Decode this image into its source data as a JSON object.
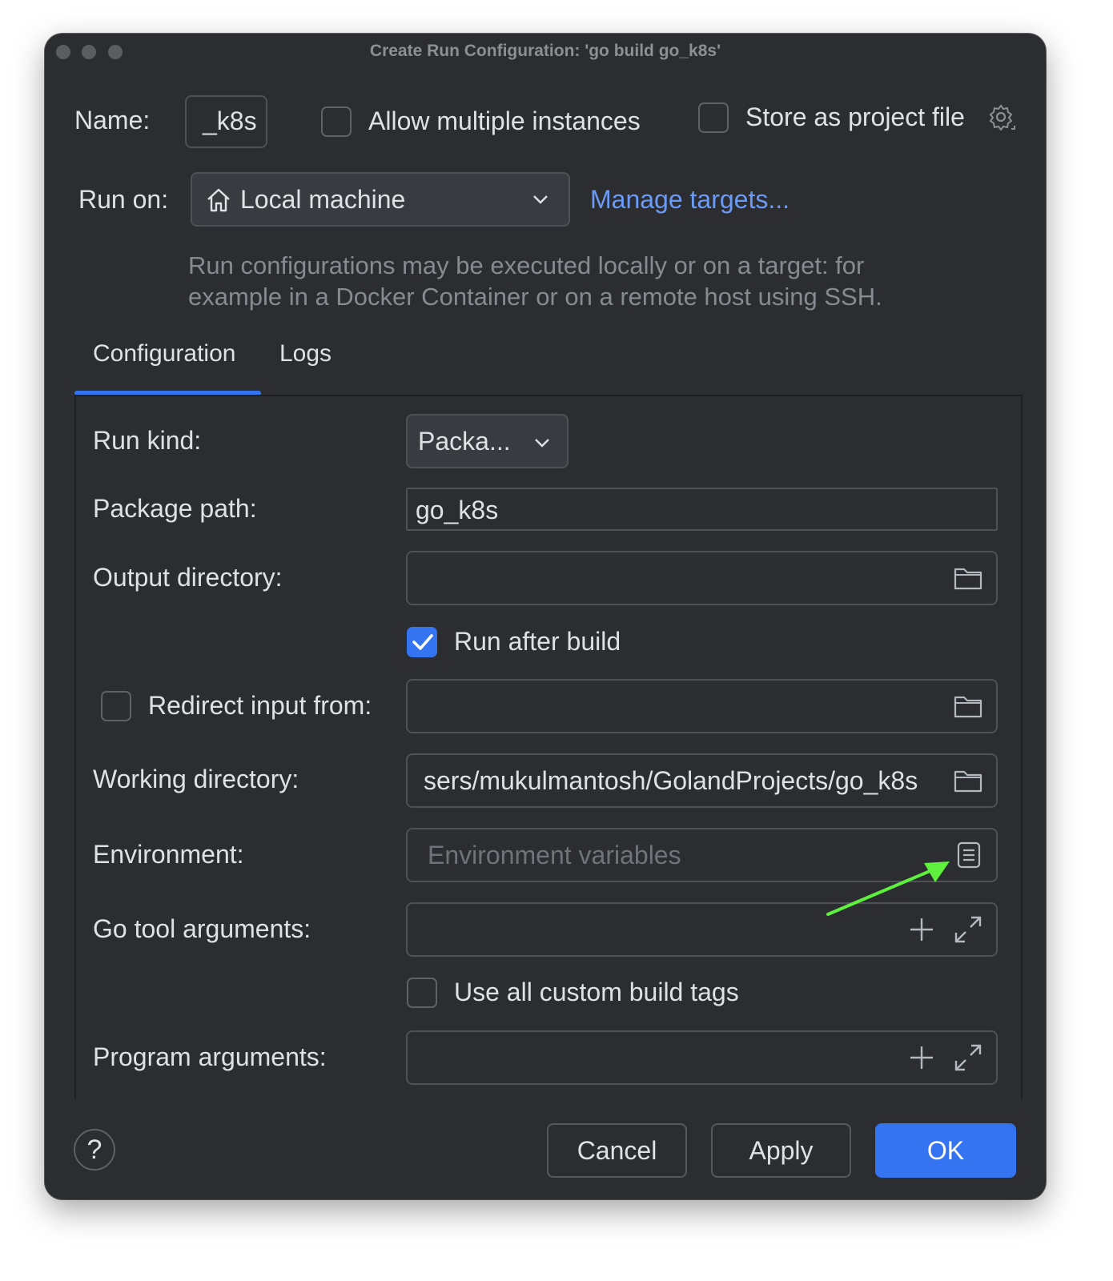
{
  "window": {
    "title": "Create Run Configuration: 'go build go_k8s'"
  },
  "header": {
    "name_label": "Name:",
    "name_value": "_k8s",
    "allow_multiple_label": "Allow multiple instances",
    "allow_multiple_checked": false,
    "store_project_label": "Store as project file",
    "store_project_checked": false
  },
  "run_on": {
    "label": "Run on:",
    "selected": "Local machine",
    "manage_targets": "Manage targets...",
    "hint_line1": "Run configurations may be executed locally or on a target: for",
    "hint_line2": "example in a Docker Container or on a remote host using SSH."
  },
  "tabs": [
    {
      "label": "Configuration",
      "active": true
    },
    {
      "label": "Logs",
      "active": false
    }
  ],
  "form": {
    "run_kind_label": "Run kind:",
    "run_kind_value": "Packa...",
    "package_path_label": "Package path:",
    "package_path_value": "go_k8s",
    "output_dir_label": "Output directory:",
    "output_dir_value": "",
    "run_after_build_label": "Run after build",
    "run_after_build_checked": true,
    "redirect_input_label": "Redirect input from:",
    "redirect_input_checked": false,
    "redirect_input_value": "",
    "working_dir_label": "Working directory:",
    "working_dir_value": "sers/mukulmantosh/GolandProjects/go_k8s",
    "environment_label": "Environment:",
    "environment_placeholder": "Environment variables",
    "go_tool_args_label": "Go tool arguments:",
    "go_tool_args_value": "",
    "custom_build_tags_label": "Use all custom build tags",
    "custom_build_tags_checked": false,
    "program_args_label": "Program arguments:",
    "program_args_value": ""
  },
  "footer": {
    "help_label": "?",
    "cancel_label": "Cancel",
    "apply_label": "Apply",
    "ok_label": "OK"
  },
  "colors": {
    "background": "#2b2d30",
    "text": "#dfe1e5",
    "accent": "#3574f0",
    "link": "#6b9bf7",
    "annotation_arrow": "#5ef03c"
  },
  "icons": [
    "home-icon",
    "chevron-down-icon",
    "gear-icon",
    "folder-icon",
    "list-icon",
    "plus-icon",
    "expand-icon",
    "checkmark-icon"
  ]
}
